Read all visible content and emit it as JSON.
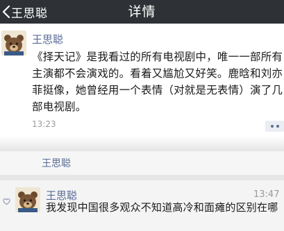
{
  "nav": {
    "back_label": "王思聪",
    "title": "详情"
  },
  "post": {
    "author": "王思聪",
    "text": "《择天记》是我看过的所有电视剧中，唯一一部所有主演都不会演戏的。看着又尴尬又好笑。鹿晗和刘亦菲挺像，她曾经用一个表情（对就是无表情）演了几部电视剧。",
    "time": "13:23"
  },
  "repost": {
    "author": "王思聪"
  },
  "comment": {
    "author": "王思聪",
    "time": "13:47",
    "text": "我发现中国很多观众不知道高冷和面瘫的区别在哪"
  },
  "colors": {
    "navbar": "#2e3135",
    "author_link": "#576b95",
    "meta_text": "#9a9a9a"
  },
  "icons": [
    "back-chevron-icon",
    "more-dots-icon",
    "heart-icon",
    "bear-avatar"
  ]
}
